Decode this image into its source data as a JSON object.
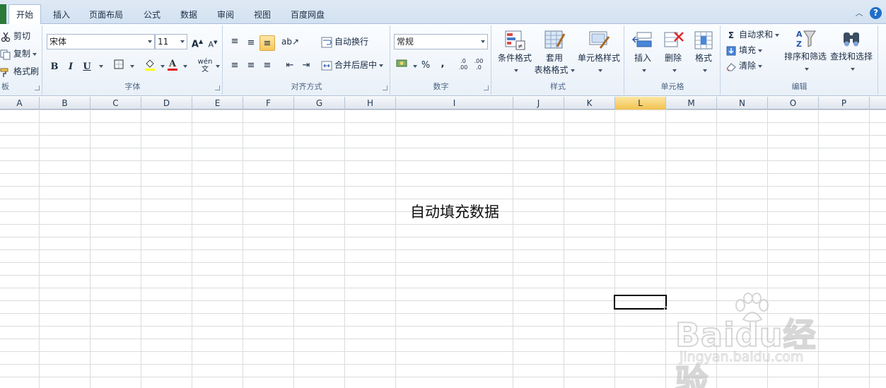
{
  "tabs": [
    "开始",
    "插入",
    "页面布局",
    "公式",
    "数据",
    "审阅",
    "视图",
    "百度网盘"
  ],
  "ribbon": {
    "clipboard": {
      "label": "板",
      "cut": "剪切",
      "copy": "复制",
      "format_painter": "格式刷"
    },
    "font": {
      "label": "字体",
      "name": "宋体",
      "size": "11",
      "bold": "B",
      "italic": "I",
      "underline": "U",
      "phonetic": "wén 文"
    },
    "alignment": {
      "label": "对齐方式",
      "wrap_text": "自动换行",
      "merge_center": "合并后居中"
    },
    "number": {
      "label": "数字",
      "format": "常规",
      "percent": "%",
      "comma": ",",
      "inc_decimal": ".0 .00",
      "dec_decimal": ".00 .0"
    },
    "styles": {
      "label": "样式",
      "conditional": "条件格式",
      "table_format_1": "套用",
      "table_format_2": "表格格式",
      "cell_styles": "单元格样式"
    },
    "cells": {
      "label": "单元格",
      "insert": "插入",
      "delete": "删除",
      "format": "格式"
    },
    "editing": {
      "label": "编辑",
      "autosum": "自动求和",
      "fill": "填充",
      "clear": "清除",
      "sort_filter": "排序和筛选",
      "find_select": "查找和选择"
    }
  },
  "sheet": {
    "columns": [
      "A",
      "B",
      "C",
      "D",
      "E",
      "F",
      "G",
      "H",
      "I",
      "J",
      "K",
      "L",
      "M",
      "N",
      "O",
      "P"
    ],
    "selected_column": "L",
    "cell_text": "自动填充数据"
  },
  "watermark": {
    "logo": "Baidu经验",
    "url": "jingyan.baidu.com"
  },
  "colors": {
    "accent": "#1f6fc9",
    "selected_header": "#f2c24f",
    "grid": "#dadcdd"
  }
}
